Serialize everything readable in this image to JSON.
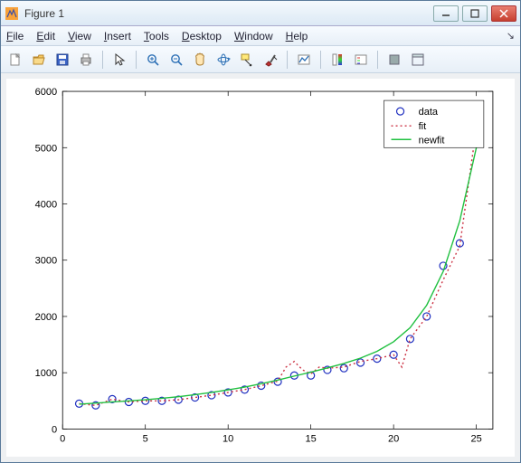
{
  "window": {
    "title": "Figure 1"
  },
  "menu": {
    "file": "File",
    "edit": "Edit",
    "view": "View",
    "insert": "Insert",
    "tools": "Tools",
    "desktop": "Desktop",
    "window": "Window",
    "help": "Help"
  },
  "toolbar": {
    "new": "new-file-icon",
    "open": "open-file-icon",
    "save": "save-icon",
    "print": "print-icon",
    "pointer": "pointer-icon",
    "zoomin": "zoom-in-icon",
    "zoomout": "zoom-out-icon",
    "pan": "pan-icon",
    "rotate": "rotate-3d-icon",
    "datacursor": "data-cursor-icon",
    "brush": "brush-icon",
    "link": "link-plot-icon",
    "colorbar": "colorbar-icon",
    "legend": "legend-icon",
    "hide": "hide-tools-icon",
    "dock": "dock-icon"
  },
  "legend": {
    "data": "data",
    "fit": "fit",
    "newfit": "newfit"
  },
  "axes": {
    "xticks": [
      0,
      5,
      10,
      15,
      20,
      25
    ],
    "yticks": [
      0,
      1000,
      2000,
      3000,
      4000,
      5000,
      6000
    ]
  },
  "chart_data": {
    "type": "scatter",
    "title": "",
    "xlabel": "",
    "ylabel": "",
    "xlim": [
      0,
      26
    ],
    "ylim": [
      0,
      6000
    ],
    "series": [
      {
        "name": "data",
        "style": "open-circles",
        "color": "#2030c0",
        "x": [
          1,
          2,
          3,
          4,
          5,
          6,
          7,
          8,
          9,
          10,
          11,
          12,
          13,
          14,
          15,
          16,
          17,
          18,
          19,
          20,
          21,
          22,
          23,
          24,
          25
        ],
        "y": [
          450,
          420,
          530,
          480,
          500,
          500,
          520,
          560,
          600,
          650,
          700,
          770,
          840,
          950,
          950,
          1050,
          1080,
          1180,
          1250,
          1320,
          1600,
          2000,
          2900,
          3300,
          5350
        ]
      },
      {
        "name": "fit",
        "style": "dotted",
        "color": "#cc3344",
        "x": [
          1,
          2,
          3,
          4,
          5,
          6,
          7,
          8,
          9,
          10,
          11,
          12,
          13,
          13.5,
          14,
          14.5,
          15,
          15.5,
          16,
          17,
          18,
          19,
          20,
          20.5,
          21,
          22,
          23,
          24,
          25
        ],
        "y": [
          450,
          420,
          530,
          480,
          500,
          500,
          520,
          560,
          600,
          650,
          700,
          770,
          850,
          1100,
          1200,
          1050,
          980,
          1100,
          1080,
          1100,
          1200,
          1250,
          1320,
          1100,
          1600,
          2000,
          2650,
          3250,
          5350
        ]
      },
      {
        "name": "newfit",
        "style": "solid",
        "color": "#20c040",
        "x": [
          1,
          2,
          3,
          4,
          5,
          6,
          7,
          8,
          9,
          10,
          11,
          12,
          13,
          14,
          15,
          16,
          17,
          18,
          19,
          20,
          21,
          22,
          23,
          24,
          25
        ],
        "y": [
          440,
          460,
          480,
          500,
          520,
          545,
          575,
          610,
          650,
          695,
          745,
          805,
          870,
          940,
          1010,
          1085,
          1165,
          1260,
          1380,
          1550,
          1800,
          2200,
          2800,
          3700,
          5000
        ]
      }
    ]
  }
}
